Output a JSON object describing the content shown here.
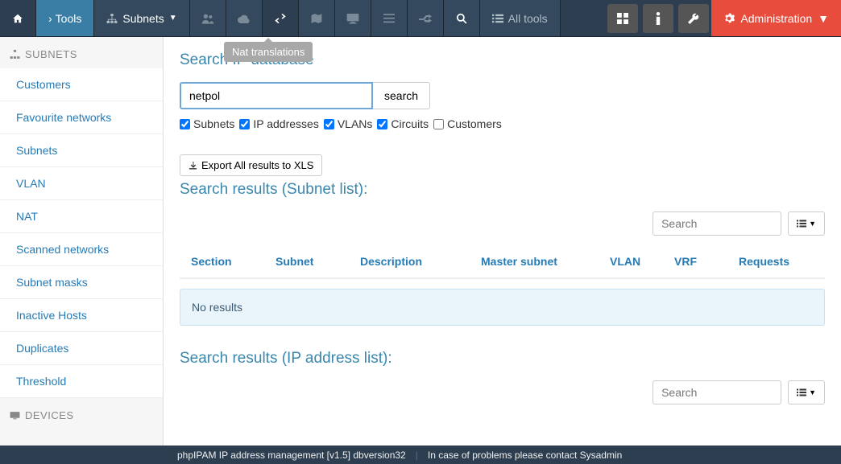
{
  "nav": {
    "tools": "Tools",
    "subnets": "Subnets",
    "all_tools": "All tools",
    "administration": "Administration",
    "tooltip": "Nat translations"
  },
  "sidebar": {
    "section_subnets": "SUBNETS",
    "section_devices": "DEVICES",
    "items": [
      "Customers",
      "Favourite networks",
      "Subnets",
      "VLAN",
      "NAT",
      "Scanned networks",
      "Subnet masks",
      "Inactive Hosts",
      "Duplicates",
      "Threshold"
    ]
  },
  "search": {
    "title": "Search IP database",
    "value": "netpol",
    "button": "search",
    "filters": {
      "subnets": {
        "label": "Subnets",
        "checked": true
      },
      "ip": {
        "label": "IP addresses",
        "checked": true
      },
      "vlans": {
        "label": "VLANs",
        "checked": true
      },
      "circuits": {
        "label": "Circuits",
        "checked": true
      },
      "customers": {
        "label": "Customers",
        "checked": false
      }
    },
    "export": "Export All results to XLS"
  },
  "results_subnet": {
    "title": "Search results (Subnet list):",
    "filter_placeholder": "Search",
    "columns": {
      "section": "Section",
      "subnet": "Subnet",
      "description": "Description",
      "master": "Master subnet",
      "vlan": "VLAN",
      "vrf": "VRF",
      "requests": "Requests"
    },
    "empty": "No results"
  },
  "results_ip": {
    "title": "Search results (IP address list):",
    "filter_placeholder": "Search"
  },
  "footer": {
    "left": "phpIPAM IP address management [v1.5] dbversion32",
    "right": "In case of problems please contact Sysadmin"
  }
}
